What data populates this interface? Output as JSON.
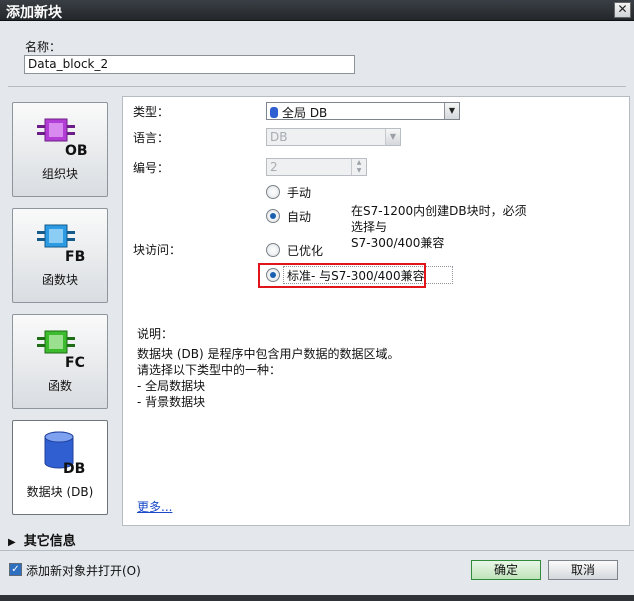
{
  "window": {
    "title": "添加新块",
    "close_glyph": "✕"
  },
  "name": {
    "label": "名称：",
    "value": "Data_block_2"
  },
  "blocks": [
    {
      "id": "ob",
      "label": "组织块",
      "code": "OB",
      "color": "#b23ed6",
      "selected": false
    },
    {
      "id": "fb",
      "label": "函数块",
      "code": "FB",
      "color": "#2d9be3",
      "selected": false
    },
    {
      "id": "fc",
      "label": "函数",
      "code": "FC",
      "color": "#3dbb2f",
      "selected": false
    },
    {
      "id": "db",
      "label": "数据块 (DB)",
      "code": "DB",
      "color": "#2f5fd0",
      "selected": true
    }
  ],
  "form": {
    "type_label": "类型：",
    "type_value": "全局 DB",
    "language_label": "语言：",
    "language_value": "DB",
    "number_label": "编号：",
    "number_value": "2",
    "manual_label": "手动",
    "auto_label": "自动",
    "auto_note_1": "在S7-1200内创建DB块时，必须",
    "auto_note_2": "选择与",
    "auto_note_3": "S7-300/400兼容",
    "access_label": "块访问：",
    "optimized_label": "已优化",
    "standard_label": "标准- 与S7-300/400兼容"
  },
  "description": {
    "heading": "说明：",
    "lines": [
      "数据块 (DB) 是程序中包含用户数据的数据区域。",
      "请选择以下类型中的一种：",
      "- 全局数据块",
      "- 背景数据块"
    ],
    "more_link": "更多..."
  },
  "footer": {
    "other_info": "其它信息",
    "open_checkbox_label": "添加新对象并打开(O)",
    "open_checked": true,
    "ok_label": "确定",
    "cancel_label": "取消"
  },
  "colors": {
    "highlight": "#e0151b",
    "accent": "#1b5fb0"
  }
}
